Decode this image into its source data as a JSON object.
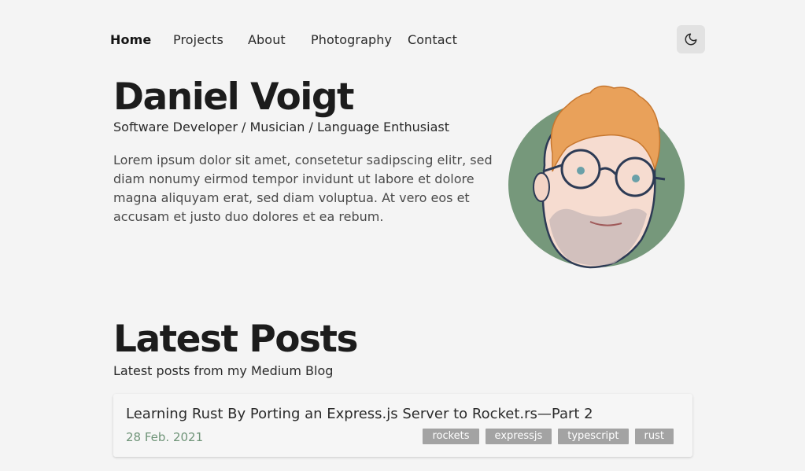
{
  "nav": {
    "items": [
      {
        "label": "Home",
        "active": true
      },
      {
        "label": "Projects"
      },
      {
        "label": "About"
      },
      {
        "label": "Photography"
      },
      {
        "label": "Contact"
      }
    ],
    "theme_toggle_icon": "moon-icon"
  },
  "hero": {
    "name": "Daniel Voigt",
    "subtitle": "Software Developer / Musician / Language Enthusiast",
    "intro": "Lorem ipsum dolor sit amet, consetetur sadipscing elitr, sed diam nonumy eirmod tempor invidunt ut labore et dolore magna aliquyam erat, sed diam voluptua. At vero eos et accusam et justo duo dolores et ea rebum."
  },
  "posts": {
    "title": "Latest Posts",
    "subtitle": "Latest posts from my Medium Blog",
    "items": [
      {
        "title": "Learning Rust By Porting an Express.js Server to Rocket.rs—Part 2",
        "date": "28 Feb. 2021",
        "tags": [
          "rockets",
          "expressjs",
          "typescript",
          "rust"
        ]
      }
    ]
  },
  "colors": {
    "background": "#f4f4f4",
    "accent_green": "#6f9478",
    "tag_bg": "#a3a3a3"
  }
}
